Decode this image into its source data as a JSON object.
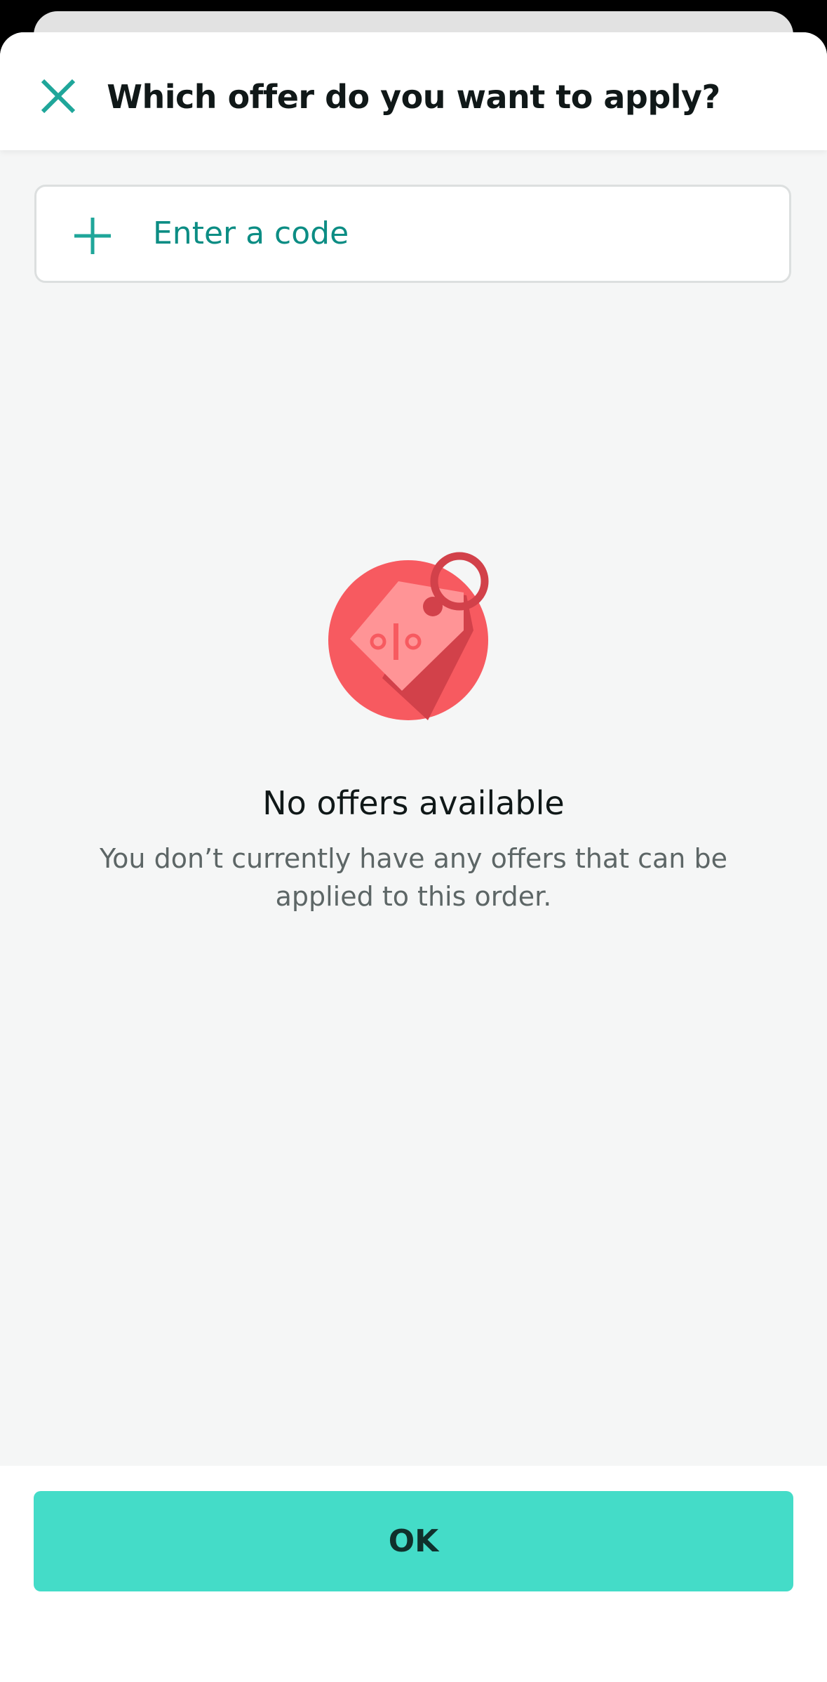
{
  "header": {
    "title": "Which offer do you want to apply?",
    "close_icon": "close-icon"
  },
  "code_entry": {
    "label": "Enter a code",
    "icon": "plus-icon"
  },
  "empty_state": {
    "illustration_icon": "discount-tag-icon",
    "title": "No offers available",
    "description": "You don’t currently have any offers that can be applied to this order."
  },
  "footer": {
    "ok_label": "OK"
  },
  "colors": {
    "accent_teal": "#1fa69a",
    "link_teal": "#0c8d84",
    "button_bg": "#44dcc8",
    "illustration_red": "#f75a60",
    "tag_pink": "#ff9496",
    "tag_shadow": "#d2414a"
  }
}
